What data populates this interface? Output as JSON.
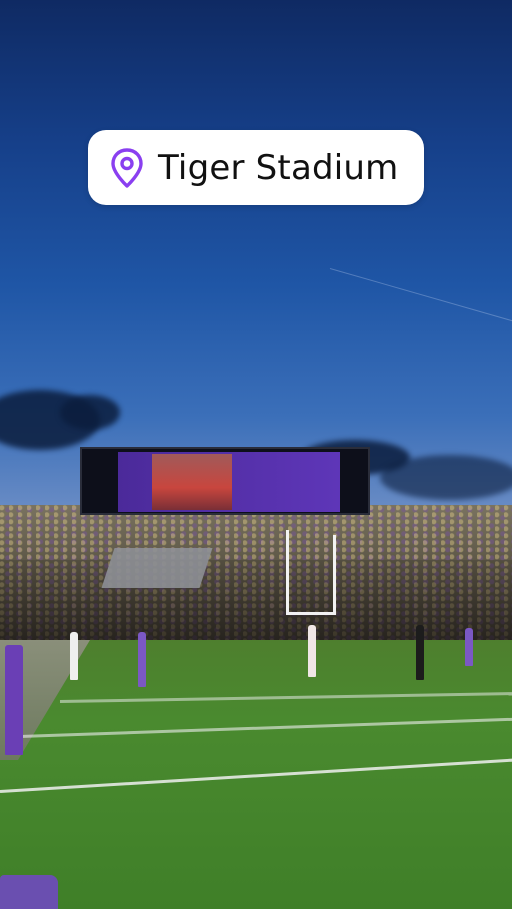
{
  "location_sticker": {
    "icon": "location-pin-icon",
    "label": "Tiger Stadium",
    "accent_color": "#8a3ff0"
  },
  "colors": {
    "sky_top": "#0f2a63",
    "field_green": "#4a8a2f",
    "team_purple": "#5e36b8"
  }
}
